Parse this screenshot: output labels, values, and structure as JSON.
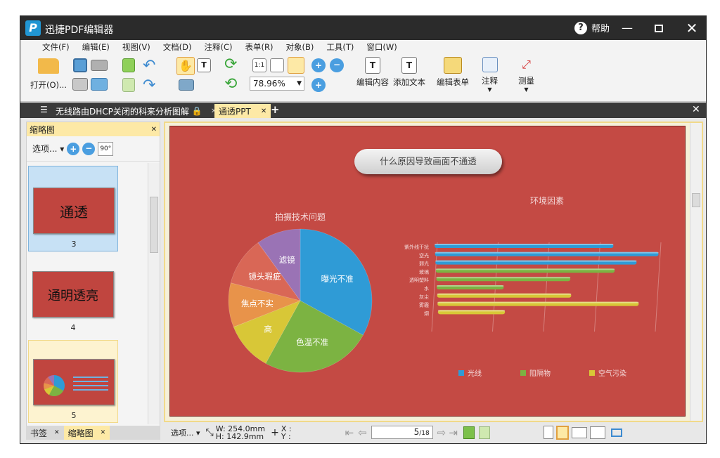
{
  "app": {
    "title": "迅捷PDF编辑器",
    "logo_letter": "P",
    "help": "帮助"
  },
  "menu": [
    "文件(F)",
    "编辑(E)",
    "视图(V)",
    "文档(D)",
    "注释(C)",
    "表单(R)",
    "对象(B)",
    "工具(T)",
    "窗口(W)"
  ],
  "toolbar": {
    "open": "打开(O)...",
    "zoom": "78.96%",
    "edit_content": "编辑内容",
    "add_text": "添加文本",
    "edit_form": "编辑表单",
    "annotate": "注释",
    "measure": "测量"
  },
  "tabs": [
    {
      "label": "无线路由DHCP关闭的科来分析图解",
      "active": false
    },
    {
      "label": "通透PPT",
      "active": true
    }
  ],
  "thumbnails": {
    "title": "缩略图",
    "options": "选项...",
    "rotate": "90°",
    "items": [
      {
        "page": "3",
        "text": "通透"
      },
      {
        "page": "4",
        "text": "通明透亮"
      },
      {
        "page": "5",
        "text": ""
      }
    ]
  },
  "bottom_tabs": [
    {
      "label": "书签",
      "active": false
    },
    {
      "label": "缩略图",
      "active": true
    }
  ],
  "slide": {
    "title": "什么原因导致画面不通透",
    "pie_title": "拍摄技术问题",
    "bar_title": "环境因素"
  },
  "chart_data": [
    {
      "type": "pie",
      "title": "拍摄技术问题",
      "labels": [
        "曝光不准",
        "色温不准",
        "高",
        "焦点不实",
        "镜头瑕疵",
        "滤镜"
      ],
      "values": [
        33,
        25,
        11,
        10,
        11,
        10
      ],
      "colors": [
        "#2f9bd6",
        "#7cb342",
        "#d8c737",
        "#e8934a",
        "#d96756",
        "#9a73b5"
      ]
    },
    {
      "type": "bar",
      "title": "环境因素",
      "categories": [
        "紫外线干扰",
        "逆光",
        "弱光",
        "玻璃",
        "透明塑料",
        "水",
        "灰尘",
        "雾霾",
        "烟"
      ],
      "series": [
        {
          "name": "光线",
          "color": "#2f9bd6",
          "values": [
            8,
            10,
            9,
            0,
            0,
            0,
            0,
            0,
            0
          ]
        },
        {
          "name": "阻隔物",
          "color": "#7cb342",
          "values": [
            0,
            0,
            0,
            8,
            6,
            3,
            0,
            0,
            0
          ]
        },
        {
          "name": "空气污染",
          "color": "#d8c737",
          "values": [
            0,
            0,
            0,
            0,
            0,
            0,
            6,
            9,
            3
          ]
        }
      ]
    }
  ],
  "statusbar": {
    "options": "选项...",
    "width": "W: 254.0mm",
    "height": "H: 142.9mm",
    "x": "X :",
    "y": "Y :",
    "page_current": "5",
    "page_total": "/18"
  }
}
